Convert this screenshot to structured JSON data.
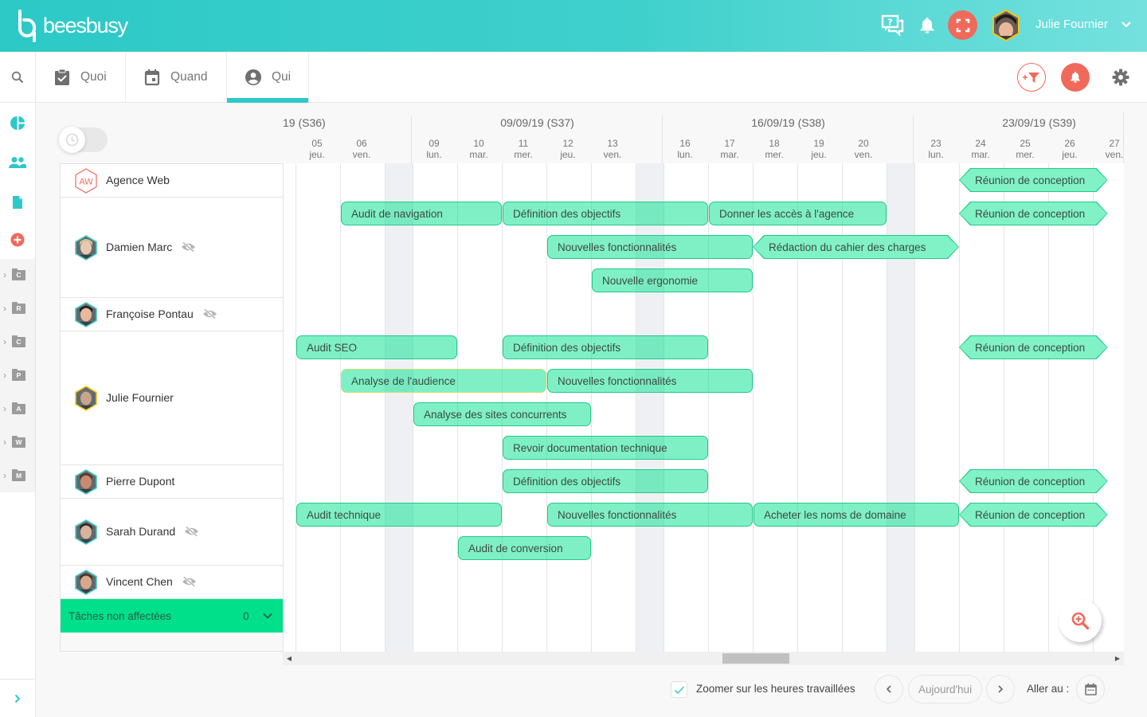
{
  "app": {
    "name": "beesbusy"
  },
  "header": {
    "help_icon": "help-chat-icon",
    "notifications_icon": "bell-icon",
    "fullscreen_icon": "fullscreen-icon",
    "user": {
      "name": "Julie Fournier",
      "avatar_border": "#f5c518"
    }
  },
  "tabs": [
    {
      "label": "Quoi",
      "icon": "clipboard-check-icon",
      "active": false
    },
    {
      "label": "Quand",
      "icon": "calendar-icon",
      "active": false
    },
    {
      "label": "Qui",
      "icon": "user-circle-icon",
      "active": true
    }
  ],
  "toolbar": {
    "filter_icon": "add-filter-icon",
    "alerts_icon": "bell-icon",
    "settings_icon": "gear-icon"
  },
  "sidebar": {
    "nav": [
      {
        "icon": "pie-chart-icon",
        "color": "#2ec8c8"
      },
      {
        "icon": "users-icon",
        "color": "#2ec8c8"
      },
      {
        "icon": "document-icon",
        "color": "#2ec8c8"
      },
      {
        "icon": "add-circle-icon",
        "color": "#f06a5c"
      }
    ],
    "folders": [
      {
        "letter": "C"
      },
      {
        "letter": "R"
      },
      {
        "letter": "C"
      },
      {
        "letter": "P"
      },
      {
        "letter": "A"
      },
      {
        "letter": "W"
      },
      {
        "letter": "M"
      }
    ]
  },
  "toggle": {
    "icon": "clock-icon",
    "on": false
  },
  "timeline": {
    "weeks": [
      {
        "label": "19 (S36)",
        "clipped": true
      },
      {
        "label": "09/09/19 (S37)",
        "start": "2019-09-09"
      },
      {
        "label": "16/09/19 (S38)",
        "start": "2019-09-16"
      },
      {
        "label": "23/09/19 (S39)",
        "start": "2019-09-23"
      }
    ],
    "days": [
      {
        "date": "2019-09-05",
        "num": "05",
        "dow": "jeu."
      },
      {
        "date": "2019-09-06",
        "num": "06",
        "dow": "ven."
      },
      {
        "date": "2019-09-09",
        "num": "09",
        "dow": "lun."
      },
      {
        "date": "2019-09-10",
        "num": "10",
        "dow": "mar."
      },
      {
        "date": "2019-09-11",
        "num": "11",
        "dow": "mer."
      },
      {
        "date": "2019-09-12",
        "num": "12",
        "dow": "jeu."
      },
      {
        "date": "2019-09-13",
        "num": "13",
        "dow": "ven."
      },
      {
        "date": "2019-09-16",
        "num": "16",
        "dow": "lun."
      },
      {
        "date": "2019-09-17",
        "num": "17",
        "dow": "mar."
      },
      {
        "date": "2019-09-18",
        "num": "18",
        "dow": "mer."
      },
      {
        "date": "2019-09-19",
        "num": "19",
        "dow": "jeu."
      },
      {
        "date": "2019-09-20",
        "num": "20",
        "dow": "ven."
      },
      {
        "date": "2019-09-23",
        "num": "23",
        "dow": "lun."
      },
      {
        "date": "2019-09-24",
        "num": "24",
        "dow": "mar."
      },
      {
        "date": "2019-09-25",
        "num": "25",
        "dow": "mer."
      },
      {
        "date": "2019-09-26",
        "num": "26",
        "dow": "jeu."
      },
      {
        "date": "2019-09-27",
        "num": "27",
        "dow": "ven."
      }
    ]
  },
  "resources": [
    {
      "name": "Agence Web",
      "type": "team",
      "initials": "AW",
      "avatar_border": "#f06a5c",
      "hidden": false,
      "tasks": [
        {
          "label": "Réunion de conception",
          "lane": 1,
          "start": "2019-09-24",
          "end": "2019-09-27T12:00",
          "shape": "hexagon"
        }
      ]
    },
    {
      "name": "Damien Marc",
      "type": "person",
      "avatar_border": "#4ec9c3",
      "hidden": true,
      "tasks": [
        {
          "label": "Audit de navigation",
          "lane": 1,
          "start": "2019-09-06",
          "end": "2019-09-10",
          "shape": "bar"
        },
        {
          "label": "Définition des objectifs",
          "lane": 1,
          "start": "2019-09-11",
          "end": "2019-09-16",
          "shape": "bar"
        },
        {
          "label": "Donner les accès à l'agence",
          "lane": 1,
          "start": "2019-09-17",
          "end": "2019-09-20",
          "shape": "bar"
        },
        {
          "label": "Réunion de conception",
          "lane": 1,
          "start": "2019-09-24",
          "end": "2019-09-27T12:00",
          "shape": "hexagon"
        },
        {
          "label": "Nouvelles fonctionnalités",
          "lane": 2,
          "start": "2019-09-12",
          "end": "2019-09-17",
          "shape": "bar"
        },
        {
          "label": "Rédaction du cahier des charges",
          "lane": 2,
          "start": "2019-09-18",
          "end": "2019-09-23",
          "shape": "hexagon"
        },
        {
          "label": "Nouvelle ergonomie",
          "lane": 3,
          "start": "2019-09-13",
          "end": "2019-09-17",
          "shape": "bar"
        }
      ]
    },
    {
      "name": "Françoise Pontau",
      "type": "person",
      "avatar_border": "#4ec9c3",
      "hidden": true,
      "tasks": []
    },
    {
      "name": "Julie Fournier",
      "type": "person",
      "avatar_border": "#f5c518",
      "hidden": false,
      "tasks": [
        {
          "label": "Audit SEO",
          "lane": 1,
          "start": "2019-09-05",
          "end": "2019-09-09",
          "shape": "bar"
        },
        {
          "label": "Définition des objectifs",
          "lane": 1,
          "start": "2019-09-11",
          "end": "2019-09-16",
          "shape": "bar"
        },
        {
          "label": "Réunion de conception",
          "lane": 1,
          "start": "2019-09-24",
          "end": "2019-09-27T12:00",
          "shape": "hexagon"
        },
        {
          "label": "Analyse de l'audience",
          "lane": 2,
          "start": "2019-09-06",
          "end": "2019-09-11",
          "shape": "bar",
          "highlight": true
        },
        {
          "label": "Nouvelles fonctionnalités",
          "lane": 2,
          "start": "2019-09-12",
          "end": "2019-09-17",
          "shape": "bar"
        },
        {
          "label": "Analyse des sites concurrents",
          "lane": 3,
          "start": "2019-09-09",
          "end": "2019-09-12",
          "shape": "bar"
        },
        {
          "label": "Revoir documentation technique",
          "lane": 4,
          "start": "2019-09-11",
          "end": "2019-09-16",
          "shape": "bar"
        }
      ]
    },
    {
      "name": "Pierre Dupont",
      "type": "person",
      "avatar_border": "#4ec9c3",
      "hidden": false,
      "tasks": [
        {
          "label": "Définition des objectifs",
          "lane": 1,
          "start": "2019-09-11",
          "end": "2019-09-16",
          "shape": "bar"
        },
        {
          "label": "Réunion de conception",
          "lane": 1,
          "start": "2019-09-24",
          "end": "2019-09-27T12:00",
          "shape": "hexagon"
        }
      ]
    },
    {
      "name": "Sarah Durand",
      "type": "person",
      "avatar_border": "#4ec9c3",
      "hidden": true,
      "tasks": [
        {
          "label": "Audit technique",
          "lane": 1,
          "start": "2019-09-05",
          "end": "2019-09-10",
          "shape": "bar"
        },
        {
          "label": "Nouvelles fonctionnalités",
          "lane": 1,
          "start": "2019-09-12",
          "end": "2019-09-17",
          "shape": "bar"
        },
        {
          "label": "Acheter les noms de domaine",
          "lane": 1,
          "start": "2019-09-18",
          "end": "2019-09-23",
          "shape": "bar"
        },
        {
          "label": "Réunion de conception",
          "lane": 1,
          "start": "2019-09-24",
          "end": "2019-09-27T12:00",
          "shape": "hexagon"
        },
        {
          "label": "Audit de conversion",
          "lane": 2,
          "start": "2019-09-10",
          "end": "2019-09-12",
          "shape": "bar"
        }
      ]
    },
    {
      "name": "Vincent Chen",
      "type": "person",
      "avatar_border": "#4ec9c3",
      "hidden": true,
      "tasks": []
    }
  ],
  "unassigned": {
    "label": "Tâches non affectées",
    "count": "0"
  },
  "footer": {
    "zoom_hours_label": "Zoomer sur les heures travaillées",
    "zoom_hours_checked": true,
    "today_label": "Aujourd'hui",
    "goto_label": "Aller au :"
  },
  "colors": {
    "brand": "#2ec8c8",
    "accent_red": "#f06a5c",
    "task_fill": "#80f2c6",
    "task_border": "#22c98b",
    "unassigned_bg": "#00e08a",
    "weekend_bg": "#eff0f4"
  }
}
